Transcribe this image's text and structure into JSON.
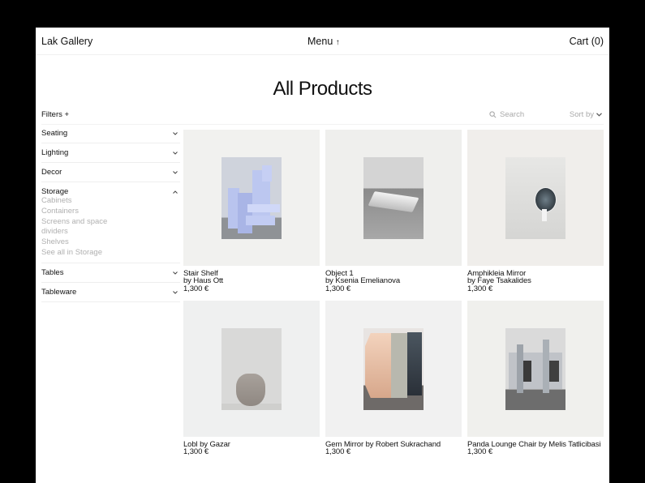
{
  "header": {
    "brand": "Lak Gallery",
    "menu_label": "Menu",
    "menu_icon": "arrow-up-icon",
    "cart_label": "Cart (0)"
  },
  "page": {
    "title": "All Products"
  },
  "toolbar": {
    "filters_label": "Filters +",
    "search_placeholder": "Search",
    "sort_label": "Sort by"
  },
  "sidebar": {
    "categories": [
      {
        "label": "Seating",
        "expanded": false
      },
      {
        "label": "Lighting",
        "expanded": false
      },
      {
        "label": "Decor",
        "expanded": false
      },
      {
        "label": "Storage",
        "expanded": true,
        "items": [
          "Cabinets",
          "Containers",
          "Screens and space",
          "dividers",
          "Shelves",
          "See all in Storage"
        ]
      },
      {
        "label": "Tables",
        "expanded": false
      },
      {
        "label": "Tableware",
        "expanded": false
      }
    ]
  },
  "products": [
    {
      "name": "Stair Shelf",
      "designer": "by Haus Ott",
      "price": "1,300 €"
    },
    {
      "name": "Object 1",
      "designer": "by Ksenia Emelianova",
      "price": "1,300 €"
    },
    {
      "name": "Amphikleia Mirror",
      "designer": "by Faye Tsakalides",
      "price": "1,300 €"
    },
    {
      "name": "Lobl by Gazar",
      "designer": "",
      "price": "1,300 €"
    },
    {
      "name": "Gem Mirror by Robert Sukrachand",
      "designer": "",
      "price": "1,300 €"
    },
    {
      "name": "Panda Lounge Chair by Melis Tatlicibasi",
      "designer": "",
      "price": "1,300 €"
    }
  ],
  "colors": {
    "background": "#000000",
    "page": "#ffffff",
    "muted_text": "#b0b0b0",
    "card_bg": "#f1f1ef"
  }
}
